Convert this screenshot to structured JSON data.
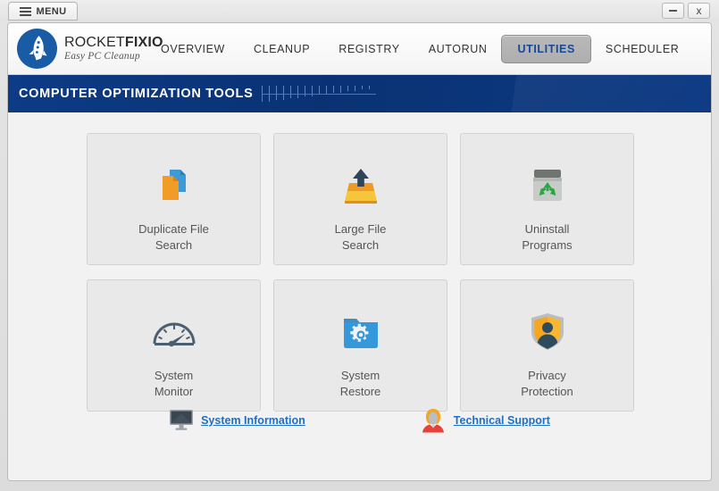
{
  "window": {
    "menu_button_label": "MENU",
    "minimize_label": "–",
    "close_label": "x"
  },
  "brand": {
    "name_part1": "ROCKET",
    "name_part2": "FIXIO",
    "tagline": "Easy PC Cleanup",
    "logo_icon": "rocket-icon",
    "logo_color": "#1a5ba6"
  },
  "nav": {
    "tabs": [
      {
        "label": "OVERVIEW",
        "active": false
      },
      {
        "label": "CLEANUP",
        "active": false
      },
      {
        "label": "REGISTRY",
        "active": false
      },
      {
        "label": "AUTORUN",
        "active": false
      },
      {
        "label": "UTILITIES",
        "active": true
      },
      {
        "label": "SCHEDULER",
        "active": false
      }
    ],
    "active_tab_color": "#16489c"
  },
  "banner": {
    "title": "COMPUTER OPTIMIZATION TOOLS",
    "background_color": "#0a3273"
  },
  "tiles": [
    {
      "label": "Duplicate File\nSearch",
      "icon": "duplicate-files-icon"
    },
    {
      "label": "Large File\nSearch",
      "icon": "large-file-tray-icon"
    },
    {
      "label": "Uninstall\nPrograms",
      "icon": "recycle-bin-icon"
    },
    {
      "label": "System\nMonitor",
      "icon": "gauge-icon"
    },
    {
      "label": "System\nRestore",
      "icon": "folder-gear-icon"
    },
    {
      "label": "Privacy\nProtection",
      "icon": "shield-person-icon"
    }
  ],
  "footer": {
    "links": [
      {
        "label": "System Information",
        "icon": "monitor-icon"
      },
      {
        "label": "Technical Support",
        "icon": "support-agent-icon"
      }
    ],
    "link_color": "#1f6fc4"
  }
}
